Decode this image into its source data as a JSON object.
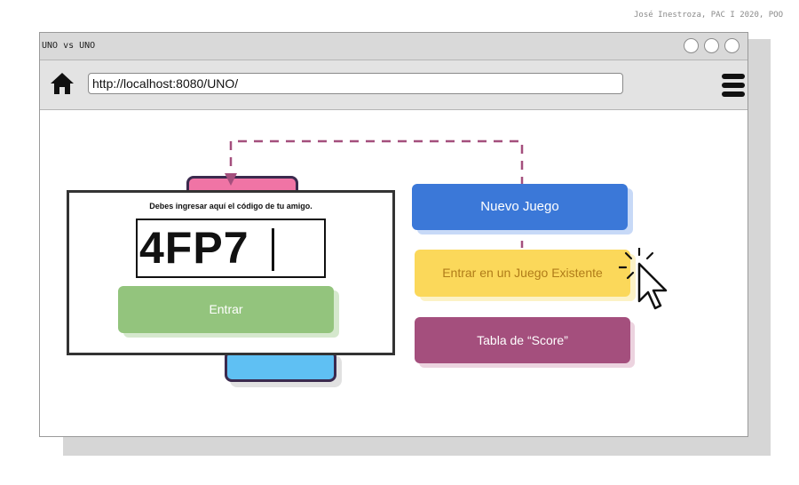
{
  "credit": "José Inestroza, PAC I 2020, POO",
  "window": {
    "title": "UNO vs UNO"
  },
  "navbar": {
    "url": "http://localhost:8080/UNO/"
  },
  "dialog": {
    "label": "Debes ingresar aquí el código de tu amigo.",
    "code_value": "4FP7",
    "submit_label": "Entrar"
  },
  "buttons": {
    "new_game": "Nuevo Juego",
    "join_game": "Entrar en un Juego Existente",
    "scoreboard": "Tabla de “Score”"
  },
  "colors": {
    "new_game": "#3b78d8",
    "join_game": "#fbd85a",
    "scoreboard": "#a44f7d",
    "submit": "#93c47d",
    "connector": "#a44f7d",
    "pink_card": "#f074a5",
    "blue_card": "#5fc0f3"
  },
  "icons": [
    "home-icon",
    "hamburger-menu-icon",
    "cursor-click-icon"
  ]
}
